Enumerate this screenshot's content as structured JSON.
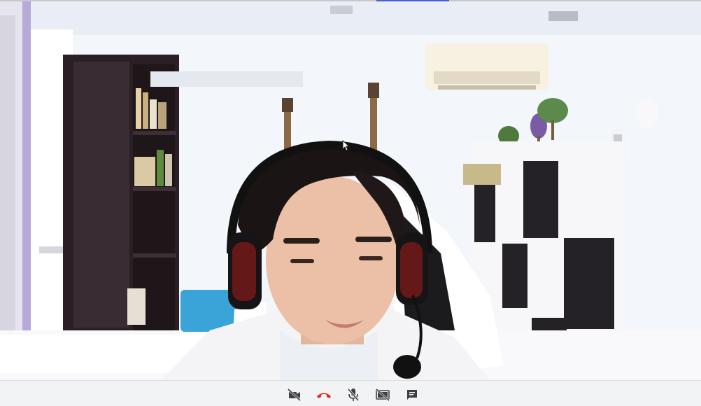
{
  "call": {
    "participant_video": "camera-feed",
    "cursor_visible": true
  },
  "controls": [
    {
      "name": "camera-off-icon",
      "state": "off",
      "color": "#3c4043"
    },
    {
      "name": "end-call-icon",
      "state": "active",
      "color": "#d93025"
    },
    {
      "name": "mic-off-icon",
      "state": "off",
      "color": "#3c4043"
    },
    {
      "name": "screen-share-off-icon",
      "state": "off",
      "color": "#3c4043"
    },
    {
      "name": "chat-icon",
      "state": "default",
      "color": "#3c4043"
    }
  ],
  "colors": {
    "control_bar_bg": "#f1f3f4",
    "end_call_red": "#d93025",
    "icon_gray": "#3c4043",
    "top_accent": "#4a5fd0"
  }
}
